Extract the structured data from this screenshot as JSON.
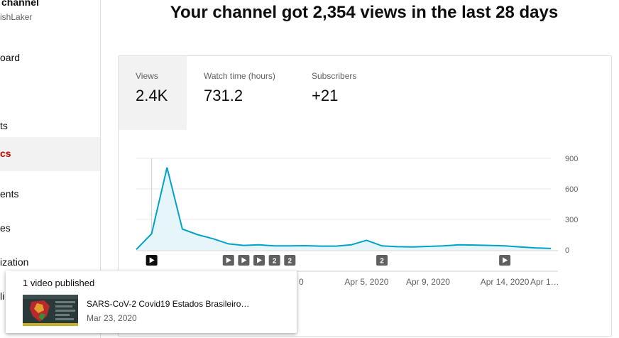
{
  "sidebar": {
    "channel_title": "channel",
    "channel_handle": "ishLaker",
    "items": [
      {
        "label": "oard"
      },
      {
        "label": "ts"
      },
      {
        "label": "cs",
        "active": true
      },
      {
        "label": "ents"
      },
      {
        "label": "es"
      },
      {
        "label": "ization"
      },
      {
        "label": "li"
      }
    ]
  },
  "headline": "Your channel got 2,354 views in the last 28 days",
  "metrics": [
    {
      "label": "Views",
      "value": "2.4K",
      "active": true
    },
    {
      "label": "Watch time (hours)",
      "value": "731.2"
    },
    {
      "label": "Subscribers",
      "value": "+21"
    }
  ],
  "chart_data": {
    "type": "area",
    "series": [
      {
        "values": [
          5,
          160,
          810,
          205,
          150,
          110,
          60,
          45,
          50,
          40,
          40,
          42,
          38,
          38,
          50,
          95,
          40,
          32,
          30,
          35,
          40,
          50,
          48,
          45,
          40,
          30,
          20,
          15
        ]
      }
    ],
    "y_ticks": [
      "900",
      "600",
      "300",
      "0"
    ],
    "ylim": [
      0,
      900
    ],
    "x_tick_labels": [
      "Apr 5, 2020",
      "Apr 9, 2020",
      "Apr 14, 2020",
      "Apr 1…"
    ],
    "hidden_tick_fragment": "0",
    "color": "#00a2c7",
    "fill_color": "#e6f5fa",
    "markers": [
      {
        "type": "play",
        "day": 1
      },
      {
        "type": "play",
        "day": 6
      },
      {
        "type": "play",
        "day": 7
      },
      {
        "type": "play",
        "day": 8
      },
      {
        "type": "count",
        "day": 9,
        "text": "2"
      },
      {
        "type": "count",
        "day": 10,
        "text": "2"
      },
      {
        "type": "count",
        "day": 16,
        "text": "2"
      },
      {
        "type": "play",
        "day": 24
      }
    ]
  },
  "popup": {
    "title": "1 video published",
    "video_title": "SARS-CoV-2 Covid19 Estados Brasileiro…",
    "video_date": "Mar 23, 2020"
  }
}
